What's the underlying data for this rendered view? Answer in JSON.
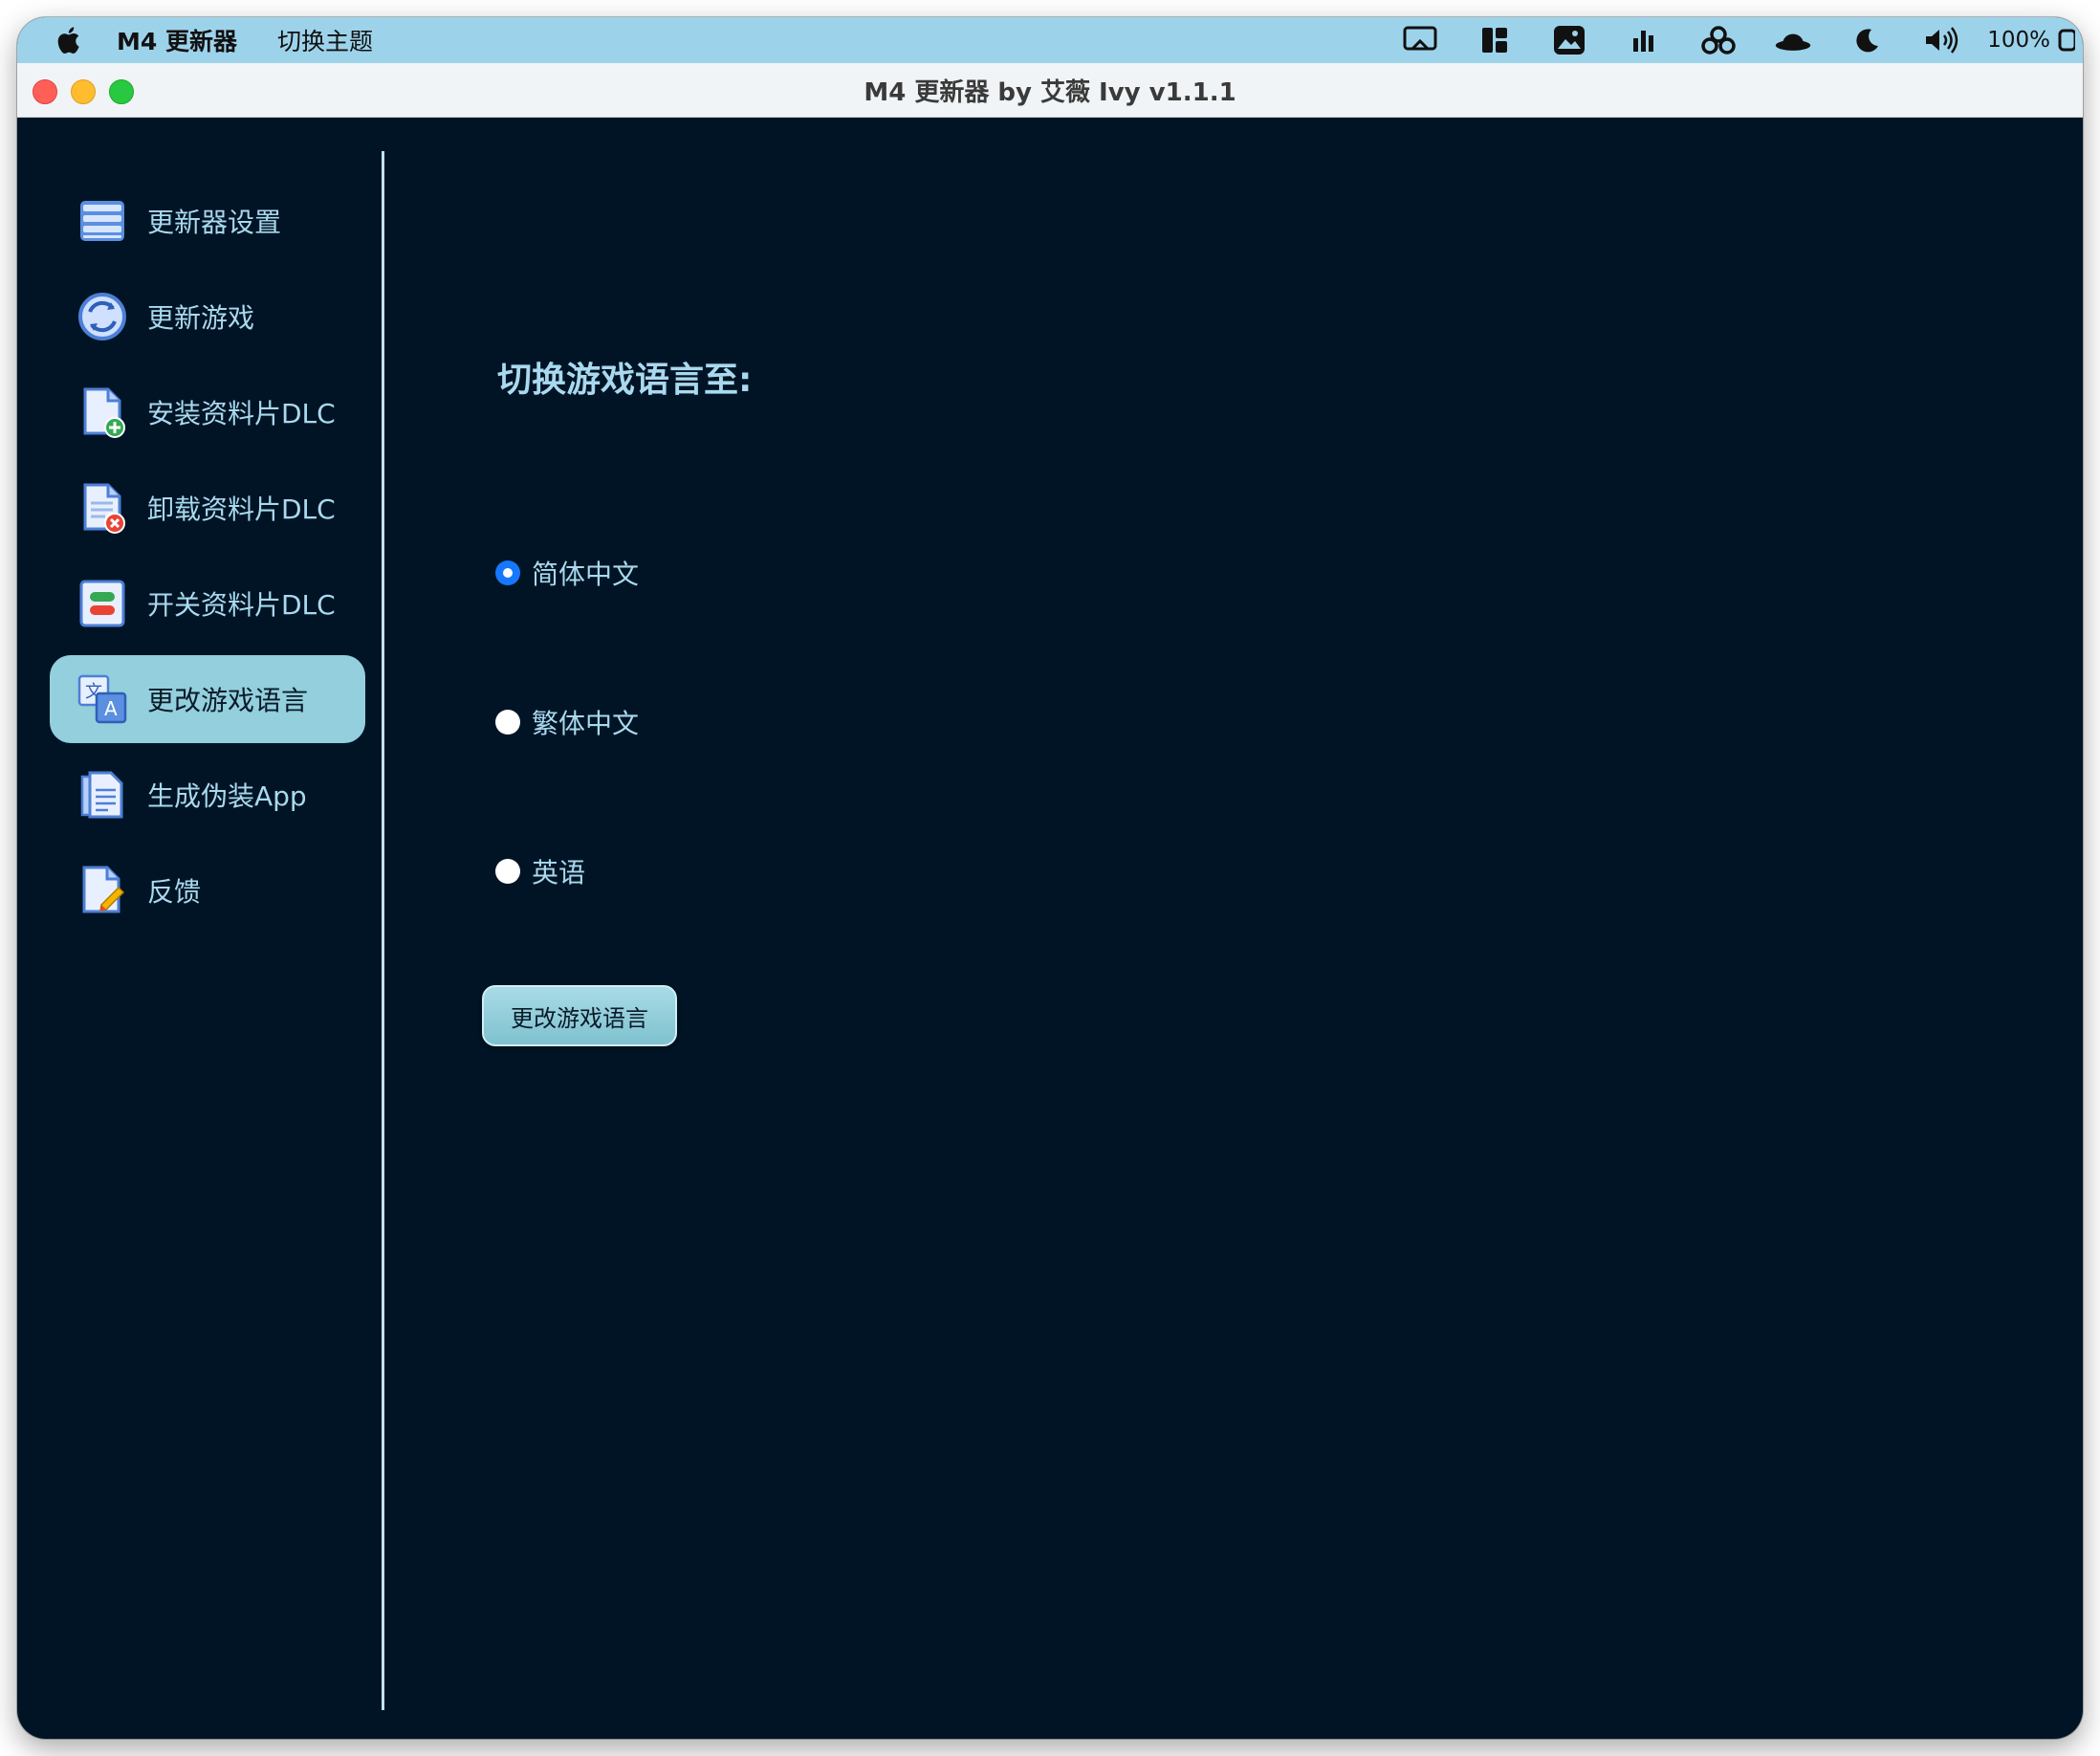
{
  "menubar": {
    "app_name": "M4 更新器",
    "menu_items": [
      "切换主题"
    ],
    "battery": "100%"
  },
  "window": {
    "title": "M4 更新器 by 艾薇 Ivy v1.1.1"
  },
  "sidebar": {
    "items": [
      {
        "label": "更新器设置",
        "icon": "list-icon"
      },
      {
        "label": "更新游戏",
        "icon": "refresh-icon"
      },
      {
        "label": "安装资料片DLC",
        "icon": "document-add-icon"
      },
      {
        "label": "卸载资料片DLC",
        "icon": "document-remove-icon"
      },
      {
        "label": "开关资料片DLC",
        "icon": "toggle-icon"
      },
      {
        "label": "更改游戏语言",
        "icon": "translate-icon",
        "active": true
      },
      {
        "label": "生成伪装App",
        "icon": "document-icon"
      },
      {
        "label": "反馈",
        "icon": "feedback-icon"
      }
    ]
  },
  "main": {
    "heading": "切换游戏语言至:",
    "options": [
      {
        "label": "简体中文",
        "checked": true
      },
      {
        "label": "繁体中文",
        "checked": false
      },
      {
        "label": "英语",
        "checked": false
      }
    ],
    "button_label": "更改游戏语言"
  },
  "colors": {
    "background": "#011425",
    "accent": "#93cfdc",
    "text": "#a9d9ee",
    "radio_selected": "#1677ff",
    "menubar": "#9dd3ea"
  }
}
